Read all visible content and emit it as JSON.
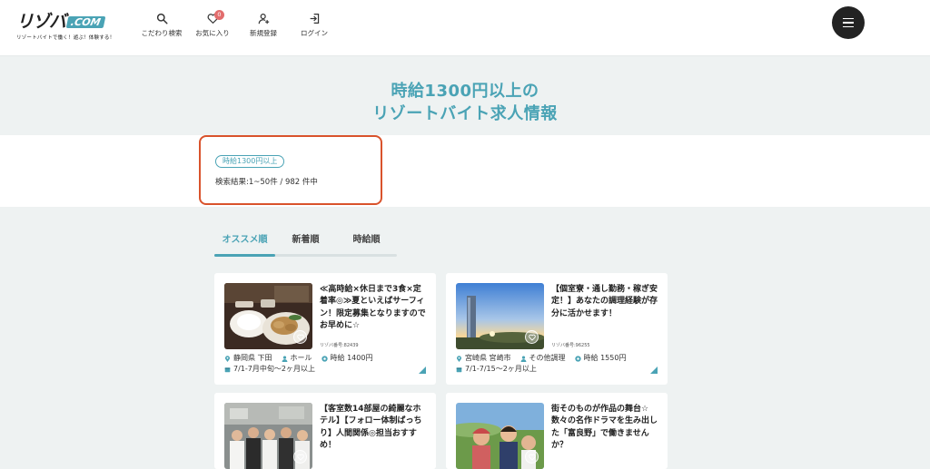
{
  "logo": {
    "text": "リゾバ",
    "com": ".COM",
    "tagline": "リゾートバイトで働く！遊ぶ！体験する！"
  },
  "nav": {
    "items": [
      {
        "label": "こだわり検索",
        "icon": "search-icon"
      },
      {
        "label": "お気に入り",
        "icon": "heart-icon",
        "badge": "0"
      },
      {
        "label": "新規登録",
        "icon": "user-plus-icon"
      },
      {
        "label": "ログイン",
        "icon": "login-icon"
      }
    ]
  },
  "page_title": {
    "line1": "時給1300円以上の",
    "line2": "リゾートバイト求人情報"
  },
  "search": {
    "condition_tag": "時給1300円以上",
    "result_text": "検索結果:1~50件 / 982 件中"
  },
  "tabs": [
    {
      "label": "オススメ順",
      "active": true
    },
    {
      "label": "新着順",
      "active": false
    },
    {
      "label": "時給順",
      "active": false
    }
  ],
  "cards": [
    {
      "title": "≪高時給×休日まで3食×定着率◎≫夏といえばサーフィン！限定募集となりますのでお早めに☆",
      "id_text": "リゾバ番号:82439",
      "location": "静岡県 下田",
      "job": "ホール",
      "wage": "時給 1400円",
      "period": "7/1-7月中旬〜2ヶ月以上"
    },
    {
      "title": "【個室寮・通し勤務・稼ぎ安定！】あなたの調理経験が存分に活かせます！",
      "id_text": "リゾバ番号:96255",
      "location": "宮崎県 宮崎市",
      "job": "その他調理",
      "wage": "時給 1550円",
      "period": "7/1-7/15〜2ヶ月以上"
    },
    {
      "title": "【客室数14部屋の綺麗なホテル】【フォロー体制ばっちり】人間関係◎担当おすすめ！",
      "id_text": "",
      "location": "",
      "job": "",
      "wage": "",
      "period": ""
    },
    {
      "title": "街そのものが作品の舞台☆数々の名作ドラマを生み出した「富良野」で働きませんか？",
      "id_text": "",
      "location": "",
      "job": "",
      "wage": "",
      "period": ""
    }
  ],
  "colors": {
    "accent": "#4aa3b5",
    "highlight_border": "#d9532c",
    "badge": "#e26d6d"
  }
}
